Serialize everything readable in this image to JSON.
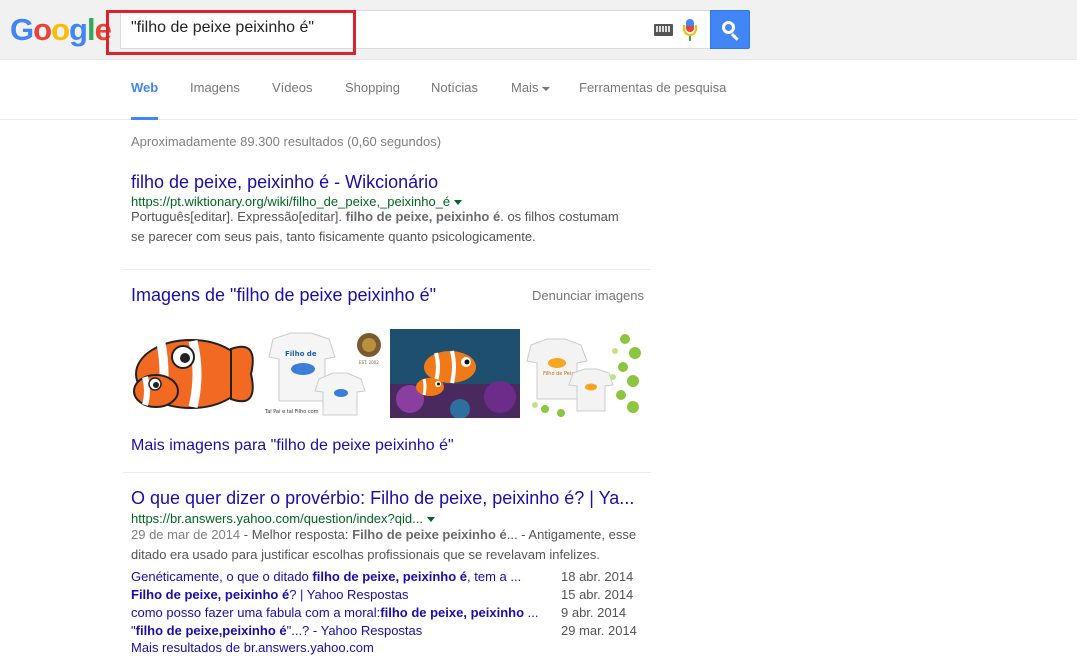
{
  "logo": {
    "letters": [
      "G",
      "o",
      "o",
      "g",
      "l",
      "e"
    ],
    "colors": [
      "#4285f4",
      "#ea4335",
      "#fbbc05",
      "#4285f4",
      "#34a853",
      "#ea4335"
    ]
  },
  "search": {
    "query": "\"filho de peixe peixinho é\""
  },
  "tabs": [
    {
      "label": "Web"
    },
    {
      "label": "Imagens"
    },
    {
      "label": "Vídeos"
    },
    {
      "label": "Shopping"
    },
    {
      "label": "Notícias"
    },
    {
      "label": "Mais"
    },
    {
      "label": "Ferramentas de pesquisa"
    }
  ],
  "stats": "Aproximadamente 89.300 resultados (0,60 segundos)",
  "result1": {
    "title": "filho de peixe, peixinho é - Wikcionário",
    "url": "https://pt.wiktionary.org/wiki/filho_de_peixe,_peixinho_é",
    "snippet_a": "Português[editar]. Expressão[editar]. ",
    "snippet_bold": "filho de peixe, peixinho é",
    "snippet_b": ". os filhos costumam",
    "snippet_line2": "se parecer com seus pais, tanto fisicamente quanto psicologicamente."
  },
  "images": {
    "heading": "Imagens de \"filho de peixe peixinho é\"",
    "report": "Denunciar imagens",
    "more": "Mais imagens para \"filho de peixe peixinho é\"",
    "shirt1_text": "Filho de",
    "shirt1_caption": "Tal Pai e tal Filho com",
    "shirt2_text": "Filho de Peixe",
    "badge_text": "EST. 2002"
  },
  "result2": {
    "title": "O que quer dizer o provérbio: Filho de peixe, peixinho é? | Ya...",
    "url": "https://br.answers.yahoo.com/question/index?qid...",
    "date": "29 de mar de 2014",
    "snippet_a": " - Melhor resposta: ",
    "snippet_bold": "Filho de peixe peixinho é",
    "snippet_b": "... - Antigamente, esse",
    "snippet_line2": "ditado era usado para justificar escolhas profissionais que se revelavam infelizes.",
    "sub": [
      {
        "pre": "Genéticamente, o que o ditado ",
        "bold": "filho de peixe, peixinho é",
        "post": ", tem a ...",
        "date": "18 abr. 2014"
      },
      {
        "pre": "",
        "bold": "Filho de peixe, peixinho é",
        "post": "? | Yahoo Respostas",
        "date": "15 abr. 2014"
      },
      {
        "pre": "como posso fazer uma fabula com a moral:",
        "bold": "filho de peixe, peixinho",
        "post": " ...",
        "date": "9 abr. 2014"
      },
      {
        "pre": "\"",
        "bold": "filho de peixe,peixinho é",
        "post": "\"...? - Yahoo Respostas",
        "date": "29 mar. 2014"
      }
    ],
    "more": "Mais resultados de br.answers.yahoo.com"
  }
}
